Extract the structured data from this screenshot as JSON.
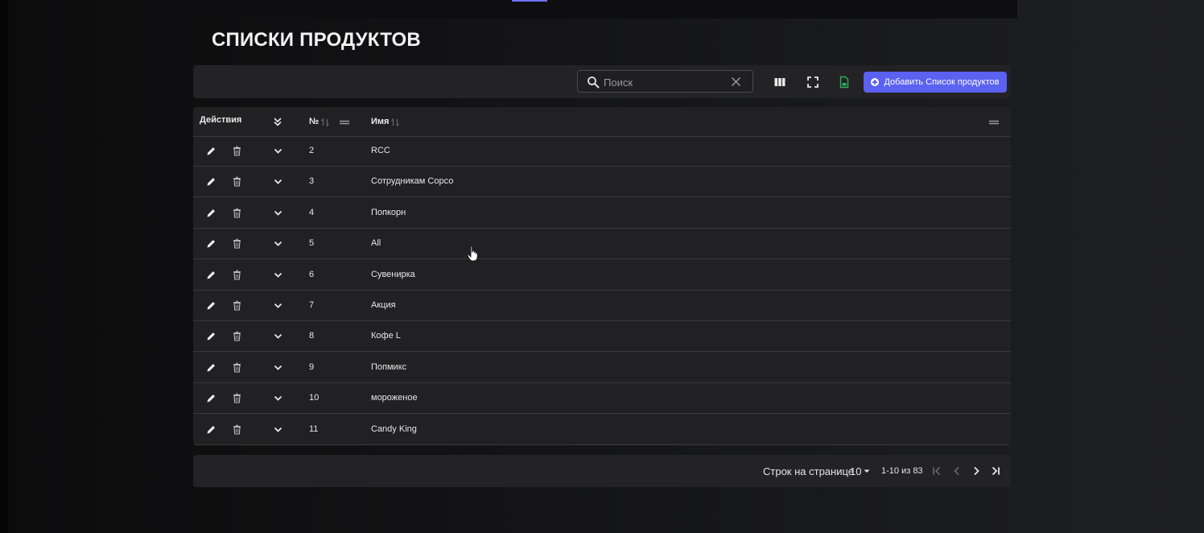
{
  "page": {
    "title": "СПИСКИ ПРОДУКТОВ"
  },
  "toolbar": {
    "search_placeholder": "Поиск",
    "add_button_label": "Добавить Список продуктов"
  },
  "table": {
    "headers": {
      "actions": "Действия",
      "number": "№",
      "name": "Имя"
    },
    "rows": [
      {
        "number": "2",
        "name": "RCC"
      },
      {
        "number": "3",
        "name": "Сотрудникам Сорсо"
      },
      {
        "number": "4",
        "name": "Попкорн"
      },
      {
        "number": "5",
        "name": "All"
      },
      {
        "number": "6",
        "name": "Сувенирка"
      },
      {
        "number": "7",
        "name": "Акция"
      },
      {
        "number": "8",
        "name": "Кофе L"
      },
      {
        "number": "9",
        "name": "Попмикс"
      },
      {
        "number": "10",
        "name": "мороженое"
      },
      {
        "number": "11",
        "name": "Candy King"
      }
    ]
  },
  "pagination": {
    "rows_per_page_label": "Строк на странице",
    "rows_per_page_value": "10",
    "range_label": "1-10 из 83"
  },
  "colors": {
    "accent": "#5b61f0",
    "panel": "#232325",
    "export_icon": "#2fae5c"
  }
}
